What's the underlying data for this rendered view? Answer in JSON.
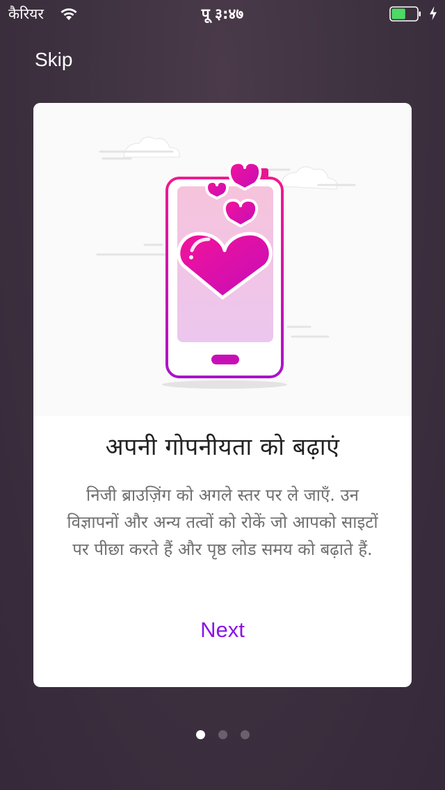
{
  "status_bar": {
    "carrier": "कैरियर",
    "time": "पू ३:४७",
    "wifi_icon": "wifi-icon",
    "battery_icon": "battery-icon",
    "battery_level": 0.55,
    "battery_color": "#4cd964",
    "charging_icon": "charging-bolt-icon"
  },
  "top_bar": {
    "skip_label": "Skip"
  },
  "card": {
    "illustration": "phone-with-hearts-illustration",
    "title": "अपनी गोपनीयता को बढ़ाएं",
    "body": "निजी ब्राउज़िंग को अगले स्तर पर ले जाएँ. उन विज्ञापनों और अन्य तत्वों को रोकें जो आपको साइटों पर पीछा करते हैं और पृष्ठ लोड समय को बढ़ाते हैं.",
    "next_label": "Next"
  },
  "pager": {
    "count": 3,
    "active_index": 0
  },
  "colors": {
    "accent": "#8a14e8",
    "heart_pink": "#e8119a",
    "background": "#3e3240"
  }
}
